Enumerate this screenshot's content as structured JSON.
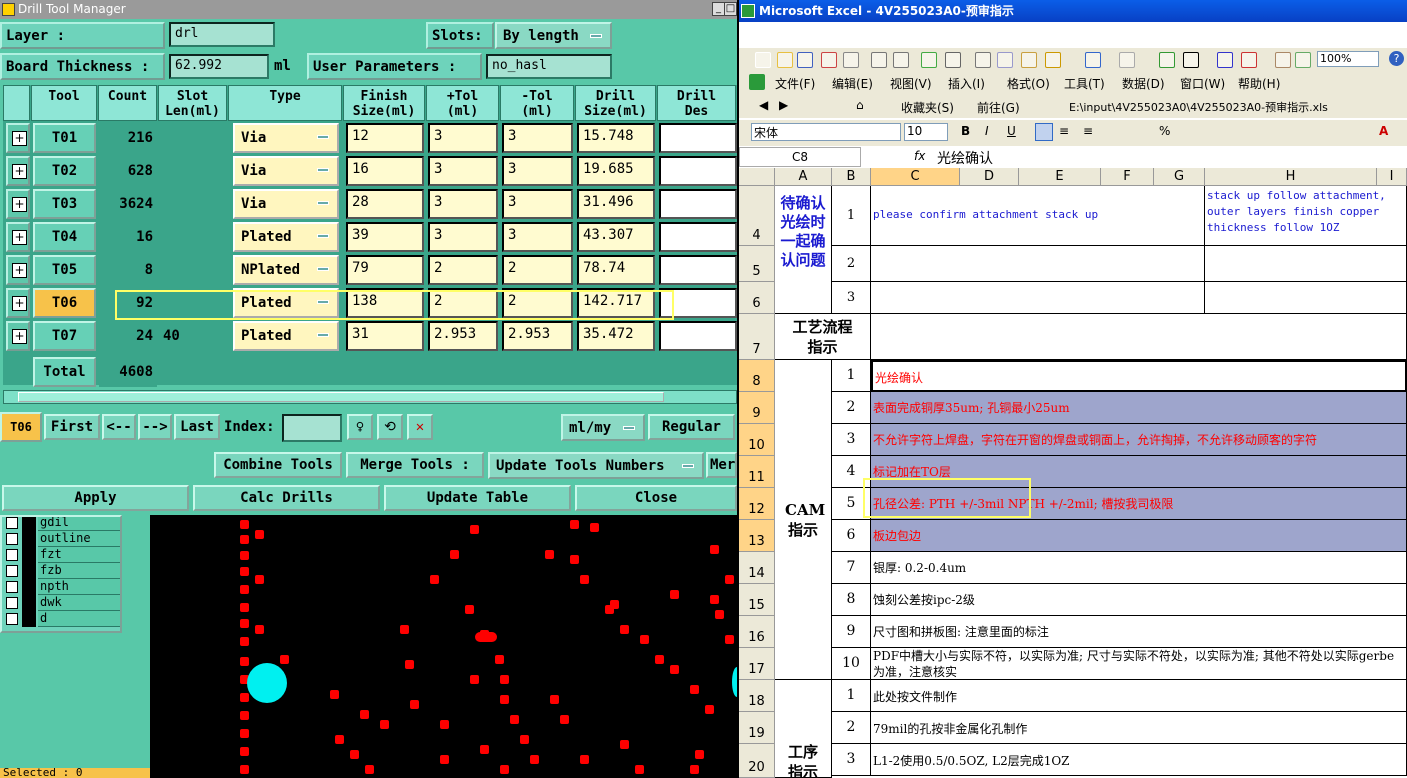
{
  "dtm": {
    "title": "Drill Tool Manager",
    "layer_label": "Layer          :",
    "layer_value": "drl",
    "slots_label": "Slots:",
    "slots_value": "By length",
    "thickness_label": "Board Thickness :",
    "thickness_value": "62.992",
    "thickness_unit": "ml",
    "user_params_label": "User Parameters :",
    "user_params_value": "no_hasl",
    "headers": [
      "Tool",
      "Count",
      "Slot\nLen(ml)",
      "Type",
      "Finish\nSize(ml)",
      "+Tol\n(ml)",
      "-Tol\n(ml)",
      "Drill\nSize(ml)",
      "Drill\nDes"
    ],
    "rows": [
      {
        "tool": "T01",
        "count": "216",
        "slot": "",
        "type": "Via",
        "finish": "12",
        "ptol": "3",
        "ntol": "3",
        "drill": "15.748"
      },
      {
        "tool": "T02",
        "count": "628",
        "slot": "",
        "type": "Via",
        "finish": "16",
        "ptol": "3",
        "ntol": "3",
        "drill": "19.685"
      },
      {
        "tool": "T03",
        "count": "3624",
        "slot": "",
        "type": "Via",
        "finish": "28",
        "ptol": "3",
        "ntol": "3",
        "drill": "31.496"
      },
      {
        "tool": "T04",
        "count": "16",
        "slot": "",
        "type": "Plated",
        "finish": "39",
        "ptol": "3",
        "ntol": "3",
        "drill": "43.307"
      },
      {
        "tool": "T05",
        "count": "8",
        "slot": "",
        "type": "NPlated",
        "finish": "79",
        "ptol": "2",
        "ntol": "2",
        "drill": "78.74"
      },
      {
        "tool": "T06",
        "count": "92",
        "slot": "",
        "type": "Plated",
        "finish": "138",
        "ptol": "2",
        "ntol": "2",
        "drill": "142.717"
      },
      {
        "tool": "T07",
        "count": "24",
        "slot": "40",
        "type": "Plated",
        "finish": "31",
        "ptol": "2.953",
        "ntol": "2.953",
        "drill": "35.472"
      }
    ],
    "total_label": "Total",
    "total_count": "4608",
    "current_tool": "T06",
    "nav": {
      "first": "First",
      "prev": "<--",
      "next": "-->",
      "last": "Last",
      "index_label": "Index:",
      "units": "ml/my",
      "mode": "Regular"
    },
    "actions": {
      "combine": "Combine Tools",
      "merge": "Merge Tools :",
      "update_numbers": "Update Tools Numbers",
      "more": "Mer"
    },
    "bottom": {
      "apply": "Apply",
      "calc": "Calc Drills",
      "update_table": "Update Table",
      "close": "Close"
    },
    "layers": [
      "gdil",
      "outline",
      "fzt",
      "fzb",
      "npth",
      "dwk",
      "d"
    ],
    "selected": "Selected : 0",
    "colors": {
      "panel": "#58c8a8",
      "selected_tool": "#f7c24a",
      "pad": "#ff0000",
      "npth_pad": "#00f0f0"
    }
  },
  "excel": {
    "title": "Microsoft Excel - 4V255023A0-预审指示",
    "menu": [
      "文件(F)",
      "编辑(E)",
      "视图(V)",
      "插入(I)",
      "格式(O)",
      "工具(T)",
      "数据(D)",
      "窗口(W)",
      "帮助(H)"
    ],
    "zoom": "100%",
    "favorites": "收藏夹(S)",
    "goto": "前往(G)",
    "path": "E:\\input\\4V255023A0\\4V255023A0-预审指示.xls",
    "font": "宋体",
    "font_size": "10",
    "name_box": "C8",
    "formula": "光绘确认",
    "cols": [
      "A",
      "B",
      "C",
      "D",
      "E",
      "F",
      "G",
      "H",
      "I"
    ],
    "rows": [
      "4",
      "5",
      "6",
      "7",
      "8",
      "9",
      "10",
      "11",
      "12",
      "13",
      "14",
      "15",
      "16",
      "17",
      "18",
      "19",
      "20"
    ],
    "confirm_label": "待确认光绘时一起确认问题",
    "confirm_items": [
      {
        "n": "1",
        "c": "please confirm attachment stack up",
        "h": "stack up follow attachment, outer layers finish copper thickness follow 1OZ"
      },
      {
        "n": "2",
        "c": "",
        "h": ""
      },
      {
        "n": "3",
        "c": "",
        "h": ""
      }
    ],
    "process_label": "工艺流程指示",
    "cam_label": "CAM指示",
    "cam_items": [
      {
        "n": "1",
        "t": "光绘确认"
      },
      {
        "n": "2",
        "t": "表面完成铜厚35um; 孔铜最小25um"
      },
      {
        "n": "3",
        "t": "不允许字符上焊盘，字符在开窗的焊盘或铜面上，允许掏掉，不允许移动顾客的字符"
      },
      {
        "n": "4",
        "t": "标记加在TO层"
      },
      {
        "n": "5",
        "t": "孔径公差: PTH +/-3mil NPTH +/-2mil; 槽按我司极限"
      },
      {
        "n": "6",
        "t": "板边包边"
      },
      {
        "n": "7",
        "t": "银厚: 0.2-0.4um"
      },
      {
        "n": "8",
        "t": "蚀刻公差按ipc-2级"
      },
      {
        "n": "9",
        "t": "尺寸图和拼板图: 注意里面的标注"
      },
      {
        "n": "10",
        "t": "PDF中槽大小与实际不符，以实际为准; 尺寸与实际不符处，以实际为准; 其他不符处以实际gerbe为准，注意核实"
      }
    ],
    "proc_label": "工序指示",
    "proc_items": [
      {
        "n": "1",
        "t": "此处按文件制作"
      },
      {
        "n": "2",
        "t": "79mil的孔按非金属化孔制作"
      },
      {
        "n": "3",
        "t": "L1-2使用0.5/0.5OZ, L2层完成1OZ"
      }
    ],
    "colors": {
      "red_text": "#ff0000",
      "blue_text": "#1a1ad0",
      "highlight": "#9ea5cc"
    }
  }
}
